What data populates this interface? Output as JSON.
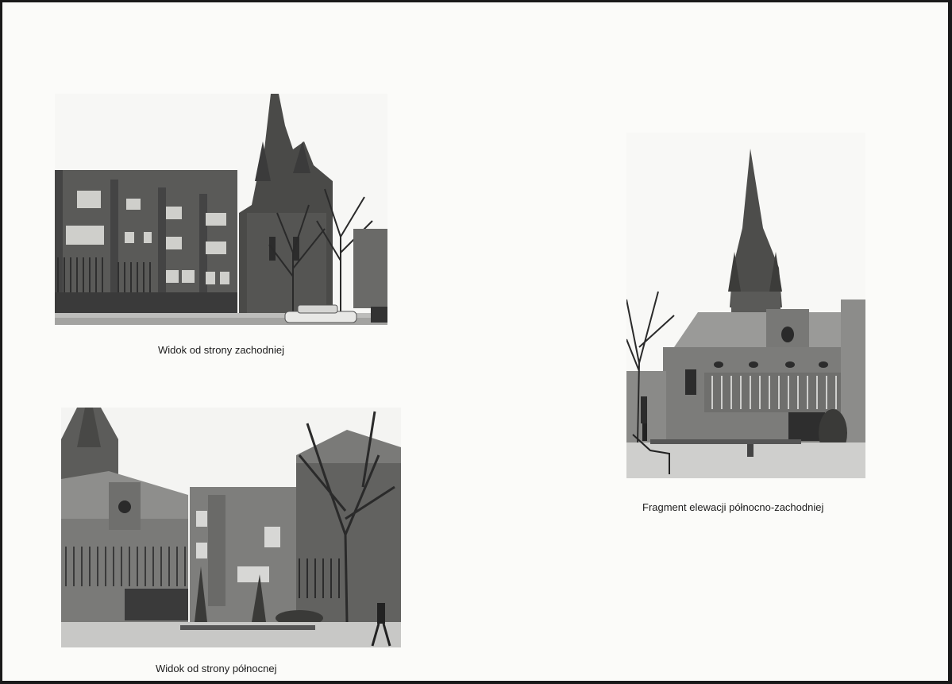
{
  "photos": [
    {
      "id": "west",
      "caption": "Widok od strony zachodniej"
    },
    {
      "id": "north",
      "caption": "Widok od strony północnej"
    },
    {
      "id": "northwest",
      "caption": "Fragment elewacji północno-zachodniej"
    }
  ]
}
